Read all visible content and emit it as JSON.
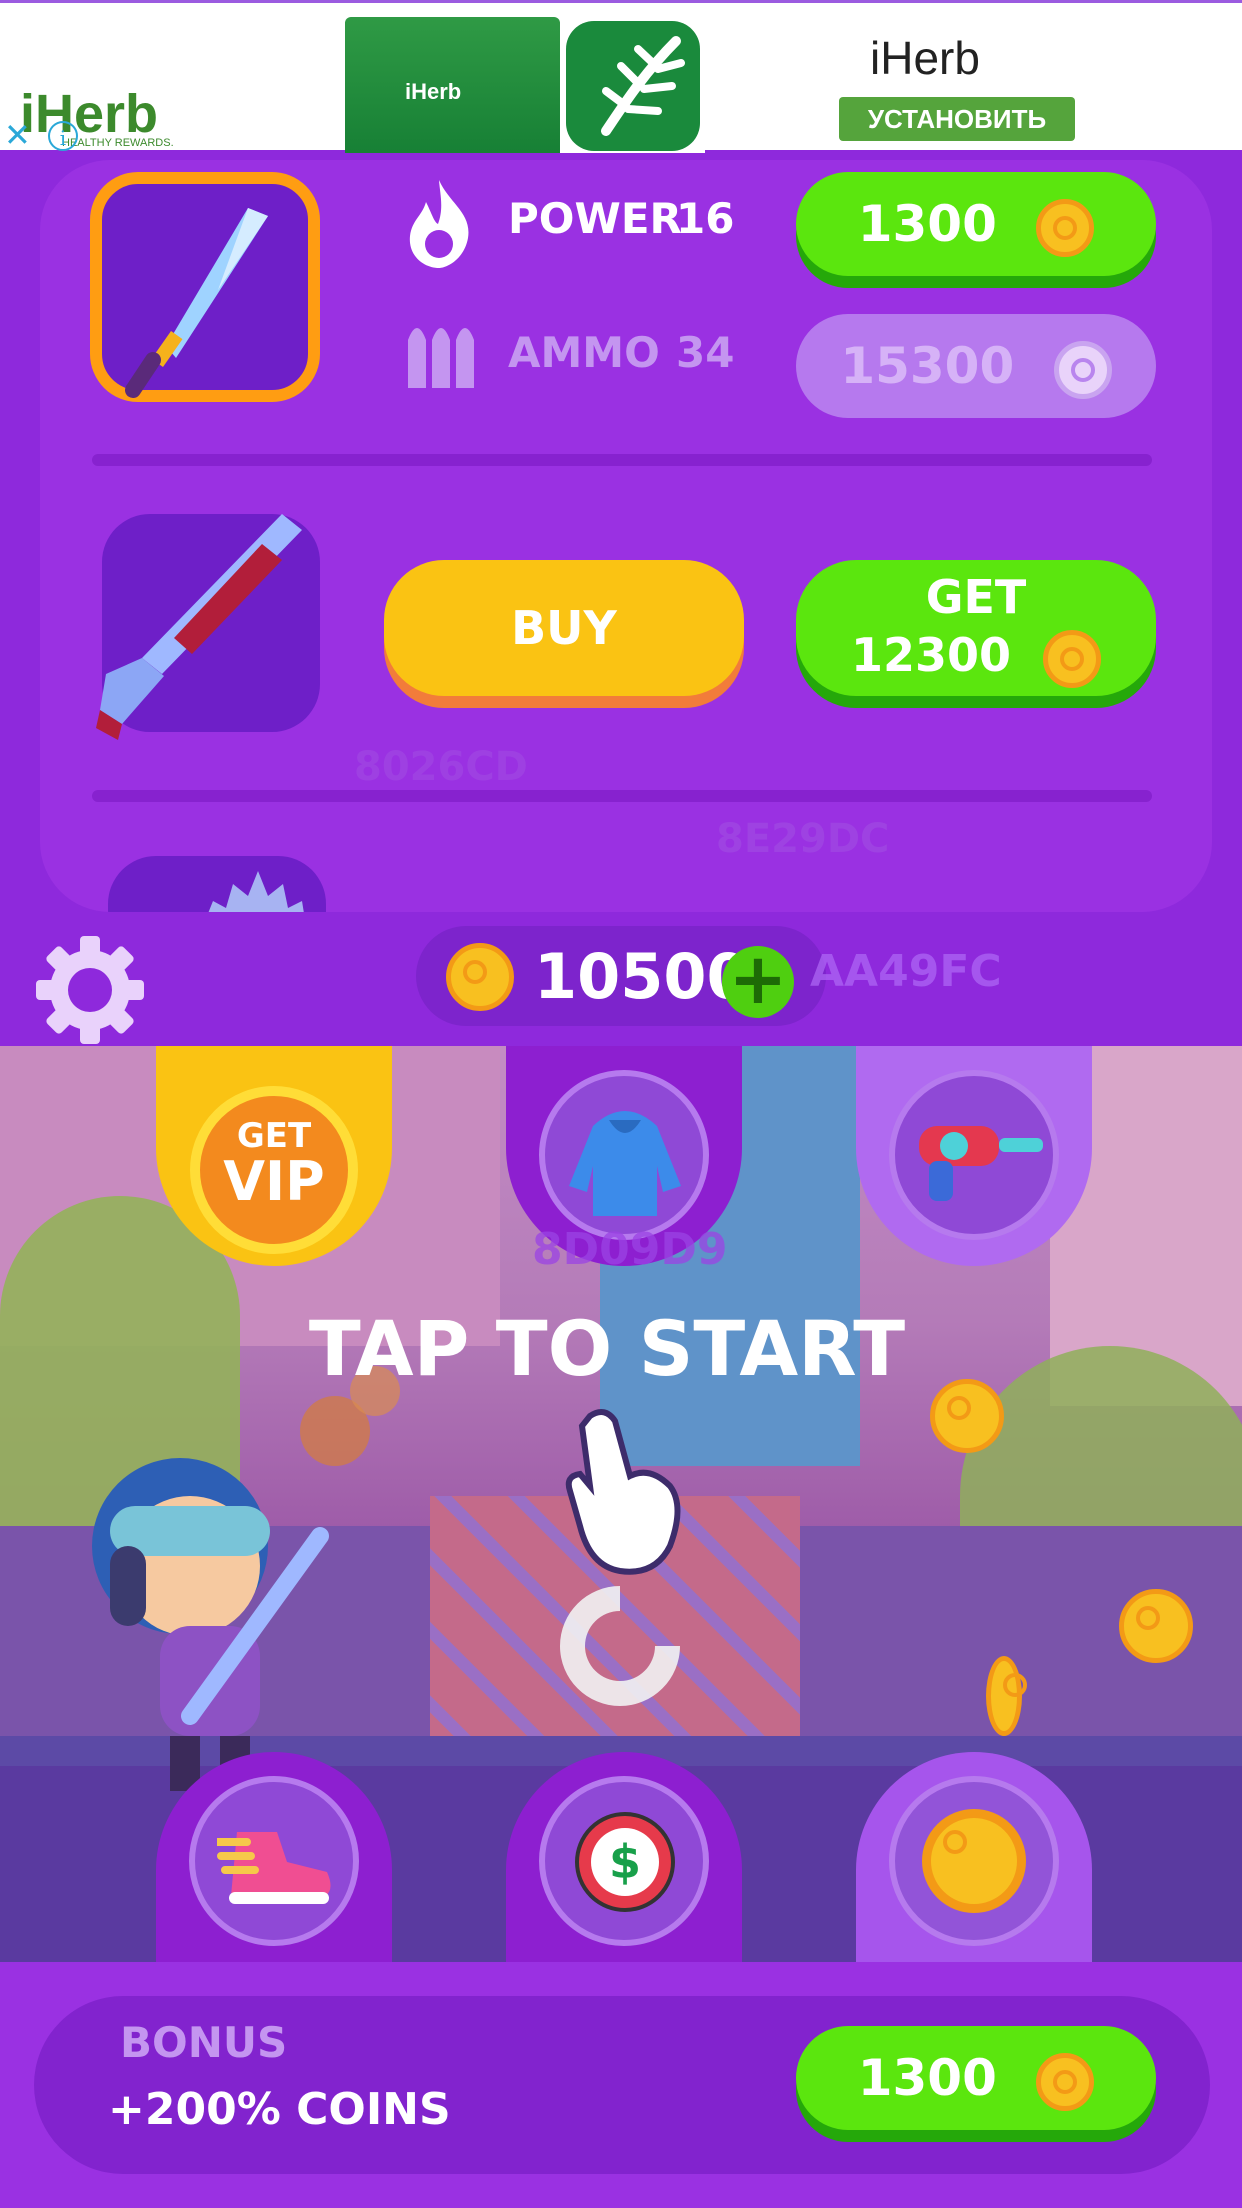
{
  "ad": {
    "brand_logo": "iHerb",
    "brand_tagline": "HEALTHY REWARDS.",
    "product_label": "iHerb",
    "title": "iHerb",
    "install_label": "УСТАНОВИТЬ",
    "close_glyph": "✕",
    "info_glyph": "i"
  },
  "shop": {
    "weapon1": {
      "icon": "katana-icon",
      "power_label": "POWER",
      "power_value": "16",
      "ammo_label": "AMMO",
      "ammo_value": "34",
      "upgrade_price": "1300",
      "ammo_price": "15300"
    },
    "weapon2": {
      "icon": "shotgun-icon",
      "buy_label": "BUY",
      "get_label": "GET",
      "get_price": "12300"
    },
    "watermarks": [
      "8026CD",
      "8E29DC"
    ]
  },
  "balance": {
    "coins": "10500",
    "plus_glyph": "+",
    "watermark": "AA49FC"
  },
  "tabs_top": [
    {
      "name": "vip",
      "line1": "GET",
      "line2": "VIP"
    },
    {
      "name": "outfit",
      "icon": "hoodie-icon"
    },
    {
      "name": "weapons",
      "icon": "ray-gun-icon"
    }
  ],
  "scene": {
    "tap_to_start": "TAP TO START",
    "watermark": "8D09D9"
  },
  "tabs_bottom": [
    {
      "name": "speed",
      "icon": "sneaker-icon"
    },
    {
      "name": "offline-earnings",
      "icon": "alarm-clock-dollar-icon",
      "glyph": "$"
    },
    {
      "name": "coins",
      "icon": "coin-icon"
    }
  ],
  "bonus": {
    "label": "BONUS",
    "value": "+200%  COINS",
    "price": "1300"
  },
  "colors": {
    "panel": "#9A31E2",
    "background": "#8E29DC",
    "green_button": "#5BE60E",
    "yellow_button": "#FAC313",
    "selected_border": "#FF9D12"
  }
}
